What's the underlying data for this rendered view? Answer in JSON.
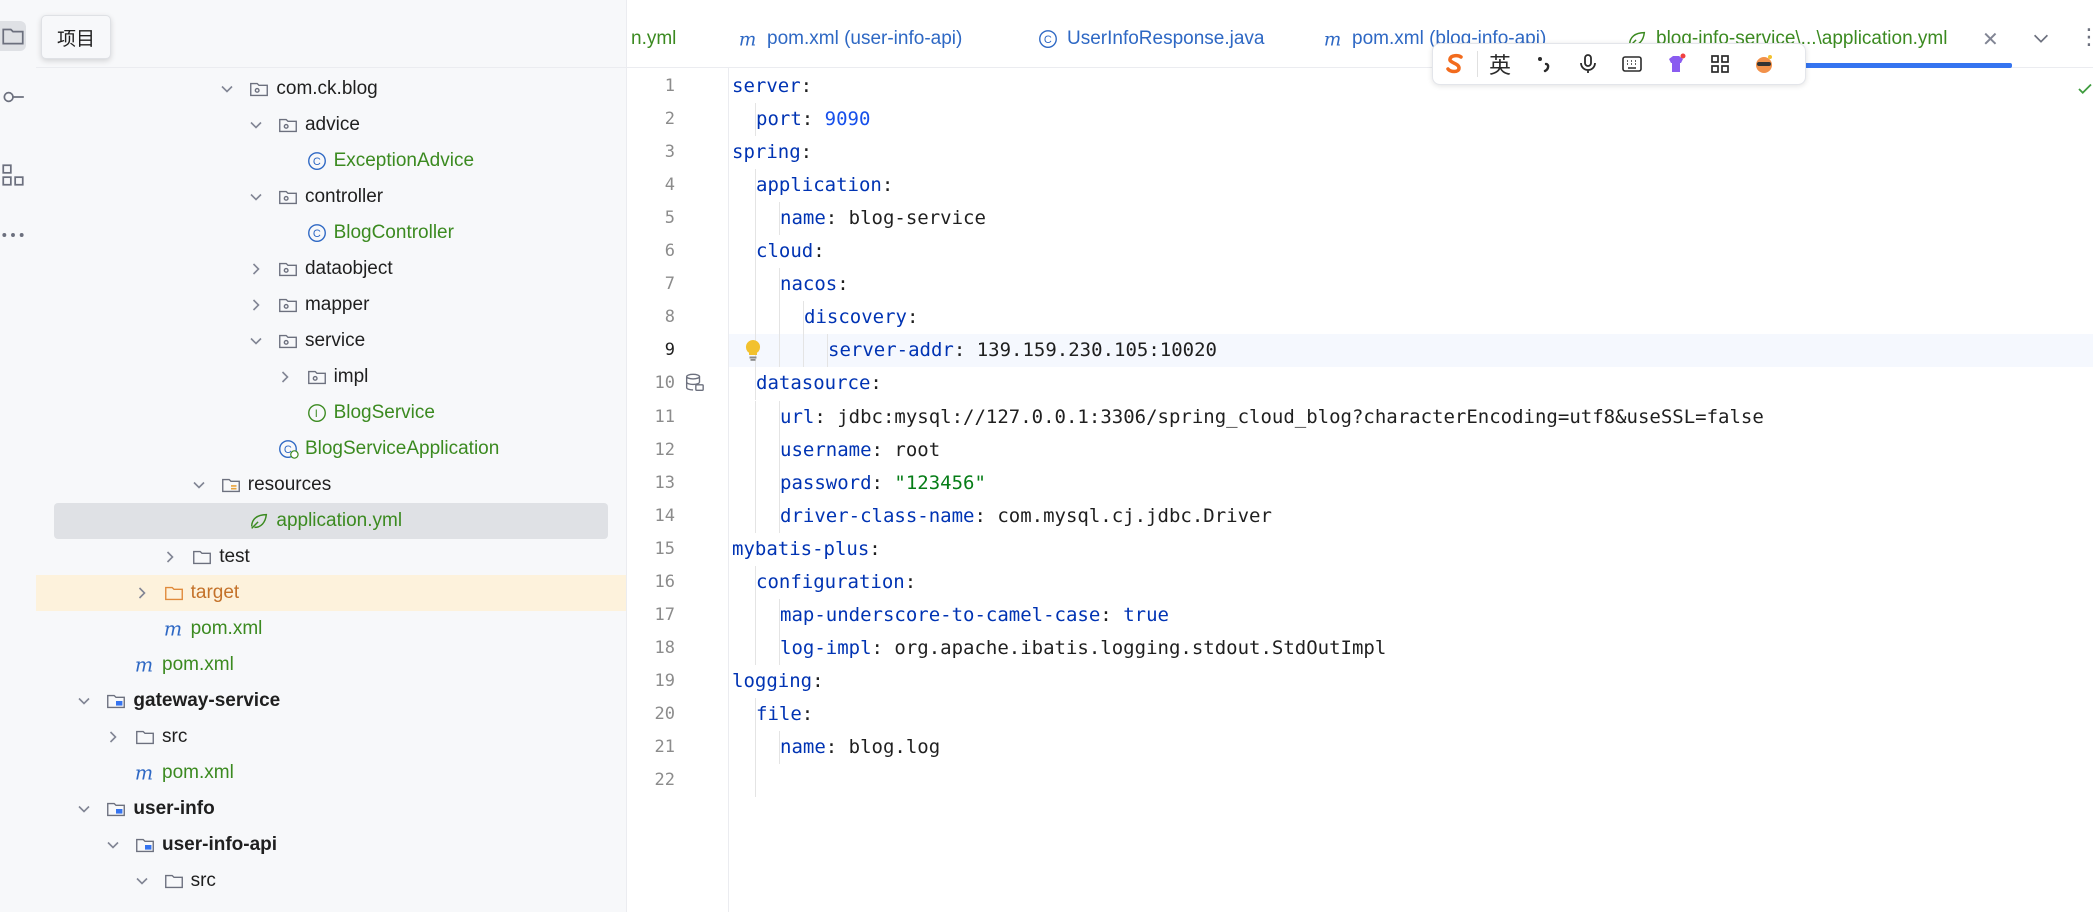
{
  "tooltip": {
    "text": "项目"
  },
  "tree": {
    "rows": [
      {
        "label": "com.ck.blog",
        "icon": "package-icon",
        "depth": 4,
        "expanded": true,
        "color": "default"
      },
      {
        "label": "advice",
        "icon": "package-icon",
        "depth": 5,
        "expanded": true,
        "color": "default"
      },
      {
        "label": "ExceptionAdvice",
        "icon": "class-icon",
        "depth": 6,
        "expanded": null,
        "color": "green"
      },
      {
        "label": "controller",
        "icon": "package-icon",
        "depth": 5,
        "expanded": true,
        "color": "default"
      },
      {
        "label": "BlogController",
        "icon": "class-icon",
        "depth": 6,
        "expanded": null,
        "color": "green"
      },
      {
        "label": "dataobject",
        "icon": "package-icon",
        "depth": 5,
        "expanded": false,
        "color": "default"
      },
      {
        "label": "mapper",
        "icon": "package-icon",
        "depth": 5,
        "expanded": false,
        "color": "default"
      },
      {
        "label": "service",
        "icon": "package-icon",
        "depth": 5,
        "expanded": true,
        "color": "default"
      },
      {
        "label": "impl",
        "icon": "package-icon",
        "depth": 6,
        "expanded": false,
        "color": "default"
      },
      {
        "label": "BlogService",
        "icon": "interface-icon",
        "depth": 6,
        "expanded": null,
        "color": "green"
      },
      {
        "label": "BlogServiceApplication",
        "icon": "spring-class-icon",
        "depth": 5,
        "expanded": null,
        "color": "green"
      },
      {
        "label": "resources",
        "icon": "resources-folder-icon",
        "depth": 3,
        "expanded": true,
        "color": "default"
      },
      {
        "label": "application.yml",
        "icon": "spring-yml-icon",
        "depth": 4,
        "expanded": null,
        "color": "green",
        "selected": true
      },
      {
        "label": "test",
        "icon": "folder-icon",
        "depth": 2,
        "expanded": false,
        "color": "default"
      },
      {
        "label": "target",
        "icon": "excluded-folder-icon",
        "depth": 1,
        "expanded": false,
        "color": "orange",
        "excluded": true
      },
      {
        "label": "pom.xml",
        "icon": "maven-icon",
        "depth": 1,
        "expanded": null,
        "color": "green"
      },
      {
        "label": "pom.xml",
        "icon": "maven-icon",
        "depth": 0,
        "expanded": null,
        "color": "green"
      },
      {
        "label": "gateway-service",
        "icon": "module-icon",
        "depth": -1,
        "expanded": true,
        "color": "bold"
      },
      {
        "label": "src",
        "icon": "folder-icon",
        "depth": 0,
        "expanded": false,
        "color": "default"
      },
      {
        "label": "pom.xml",
        "icon": "maven-icon",
        "depth": 0,
        "expanded": null,
        "color": "green"
      },
      {
        "label": "user-info",
        "icon": "module-icon",
        "depth": -1,
        "expanded": true,
        "color": "bold"
      },
      {
        "label": "user-info-api",
        "icon": "module-icon",
        "depth": 0,
        "expanded": true,
        "color": "bold"
      },
      {
        "label": "src",
        "icon": "folder-icon",
        "depth": 1,
        "expanded": true,
        "color": "default"
      }
    ]
  },
  "tabs": [
    {
      "label": "n.yml",
      "icon": "",
      "color": "green"
    },
    {
      "label": "pom.xml (user-info-api)",
      "icon": "maven-icon",
      "color": "blue"
    },
    {
      "label": "UserInfoResponse.java",
      "icon": "class-icon",
      "color": "blue"
    },
    {
      "label": "pom.xml (blog-info-api)",
      "icon": "maven-icon",
      "color": "blue"
    },
    {
      "label": "blog-info-service\\...\\application.yml",
      "icon": "spring-yml-icon",
      "color": "green"
    }
  ],
  "ime": {
    "items": [
      "sogou-logo-icon",
      "英",
      "punctuation-icon",
      "microphone-icon",
      "keyboard-icon",
      "skin-icon",
      "toolbox-icon",
      "mascot-icon"
    ]
  },
  "editor": {
    "current_line": 9,
    "lines": [
      {
        "n": "1",
        "indent": 0,
        "key": "server",
        "value": "",
        "vtype": ""
      },
      {
        "n": "2",
        "indent": 1,
        "key": "port",
        "value": "9090",
        "vtype": "num"
      },
      {
        "n": "3",
        "indent": 0,
        "key": "spring",
        "value": "",
        "vtype": ""
      },
      {
        "n": "4",
        "indent": 1,
        "key": "application",
        "value": "",
        "vtype": ""
      },
      {
        "n": "5",
        "indent": 2,
        "key": "name",
        "value": "blog-service",
        "vtype": "plain"
      },
      {
        "n": "6",
        "indent": 1,
        "key": "cloud",
        "value": "",
        "vtype": ""
      },
      {
        "n": "7",
        "indent": 2,
        "key": "nacos",
        "value": "",
        "vtype": ""
      },
      {
        "n": "8",
        "indent": 3,
        "key": "discovery",
        "value": "",
        "vtype": ""
      },
      {
        "n": "9",
        "indent": 4,
        "key": "server-addr",
        "value": "139.159.230.105:10020",
        "vtype": "plain"
      },
      {
        "n": "10",
        "indent": 1,
        "key": "datasource",
        "value": "",
        "vtype": ""
      },
      {
        "n": "11",
        "indent": 2,
        "key": "url",
        "value": "jdbc:mysql://127.0.0.1:3306/spring_cloud_blog?characterEncoding=utf8&useSSL=false",
        "vtype": "plain"
      },
      {
        "n": "12",
        "indent": 2,
        "key": "username",
        "value": "root",
        "vtype": "plain"
      },
      {
        "n": "13",
        "indent": 2,
        "key": "password",
        "value": "\"123456\"",
        "vtype": "str"
      },
      {
        "n": "14",
        "indent": 2,
        "key": "driver-class-name",
        "value": "com.mysql.cj.jdbc.Driver",
        "vtype": "plain"
      },
      {
        "n": "15",
        "indent": 0,
        "key": "mybatis-plus",
        "value": "",
        "vtype": ""
      },
      {
        "n": "16",
        "indent": 1,
        "key": "configuration",
        "value": "",
        "vtype": ""
      },
      {
        "n": "17",
        "indent": 2,
        "key": "map-underscore-to-camel-case",
        "value": "true",
        "vtype": "bool"
      },
      {
        "n": "18",
        "indent": 2,
        "key": "log-impl",
        "value": "org.apache.ibatis.logging.stdout.StdOutImpl",
        "vtype": "plain"
      },
      {
        "n": "19",
        "indent": 0,
        "key": "logging",
        "value": "",
        "vtype": ""
      },
      {
        "n": "20",
        "indent": 1,
        "key": "file",
        "value": "",
        "vtype": ""
      },
      {
        "n": "21",
        "indent": 2,
        "key": "name",
        "value": "blog.log",
        "vtype": "plain"
      },
      {
        "n": "22",
        "indent": 0,
        "key": "",
        "value": "",
        "vtype": ""
      }
    ]
  }
}
